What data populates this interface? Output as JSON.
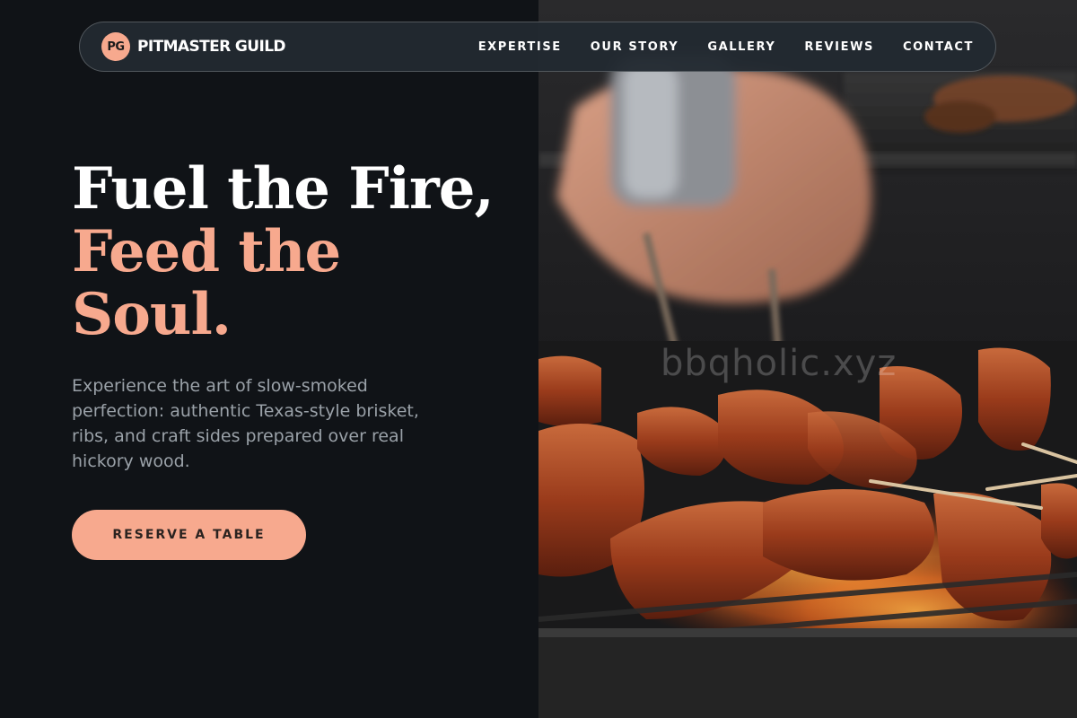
{
  "nav": {
    "logo_mark": "PG",
    "brand": "PITMASTER GUILD",
    "links": [
      {
        "label": "EXPERTISE"
      },
      {
        "label": "OUR STORY"
      },
      {
        "label": "GALLERY"
      },
      {
        "label": "REVIEWS"
      },
      {
        "label": "CONTACT"
      }
    ]
  },
  "hero": {
    "headline": {
      "line1": "Fuel the Fire,",
      "line2": "Feed the",
      "line3": "Soul."
    },
    "description": "Experience the art of slow-smoked perfection: authentic Texas-style brisket, ribs, and craft sides prepared over real hickory wood.",
    "cta_label": "RESERVE A TABLE",
    "image_watermark": "bbqholic.xyz"
  },
  "colors": {
    "background": "#101317",
    "accent": "#f7a98e",
    "nav_background": "#222a31",
    "body_text": "#9aa1a8"
  }
}
